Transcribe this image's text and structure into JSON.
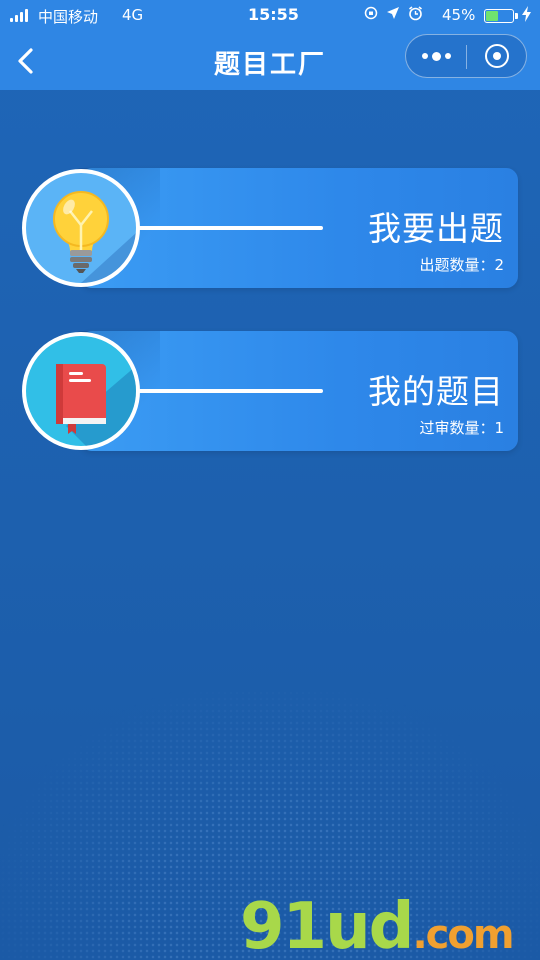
{
  "status_bar": {
    "carrier": "中国移动",
    "network": "4G",
    "time": "15:55",
    "battery_percent": "45%",
    "battery_level": 0.45
  },
  "nav": {
    "title": "题目工厂",
    "back_icon": "chevron-left-icon",
    "more_icon": "more-dots-icon",
    "close_icon": "target-close-icon"
  },
  "cards": [
    {
      "title": "我要出题",
      "subtitle": "出题数量：2",
      "icon": "lightbulb-icon"
    },
    {
      "title": "我的题目",
      "subtitle": "过审数量：1",
      "icon": "book-icon"
    }
  ],
  "watermark": {
    "main": "91ud",
    "suffix": ".com"
  },
  "colors": {
    "bar": "#2f86e4",
    "background": "#1e64b4",
    "card": "#3b9cf4",
    "bulb": "#ffd23a",
    "book": "#e94b4b"
  }
}
